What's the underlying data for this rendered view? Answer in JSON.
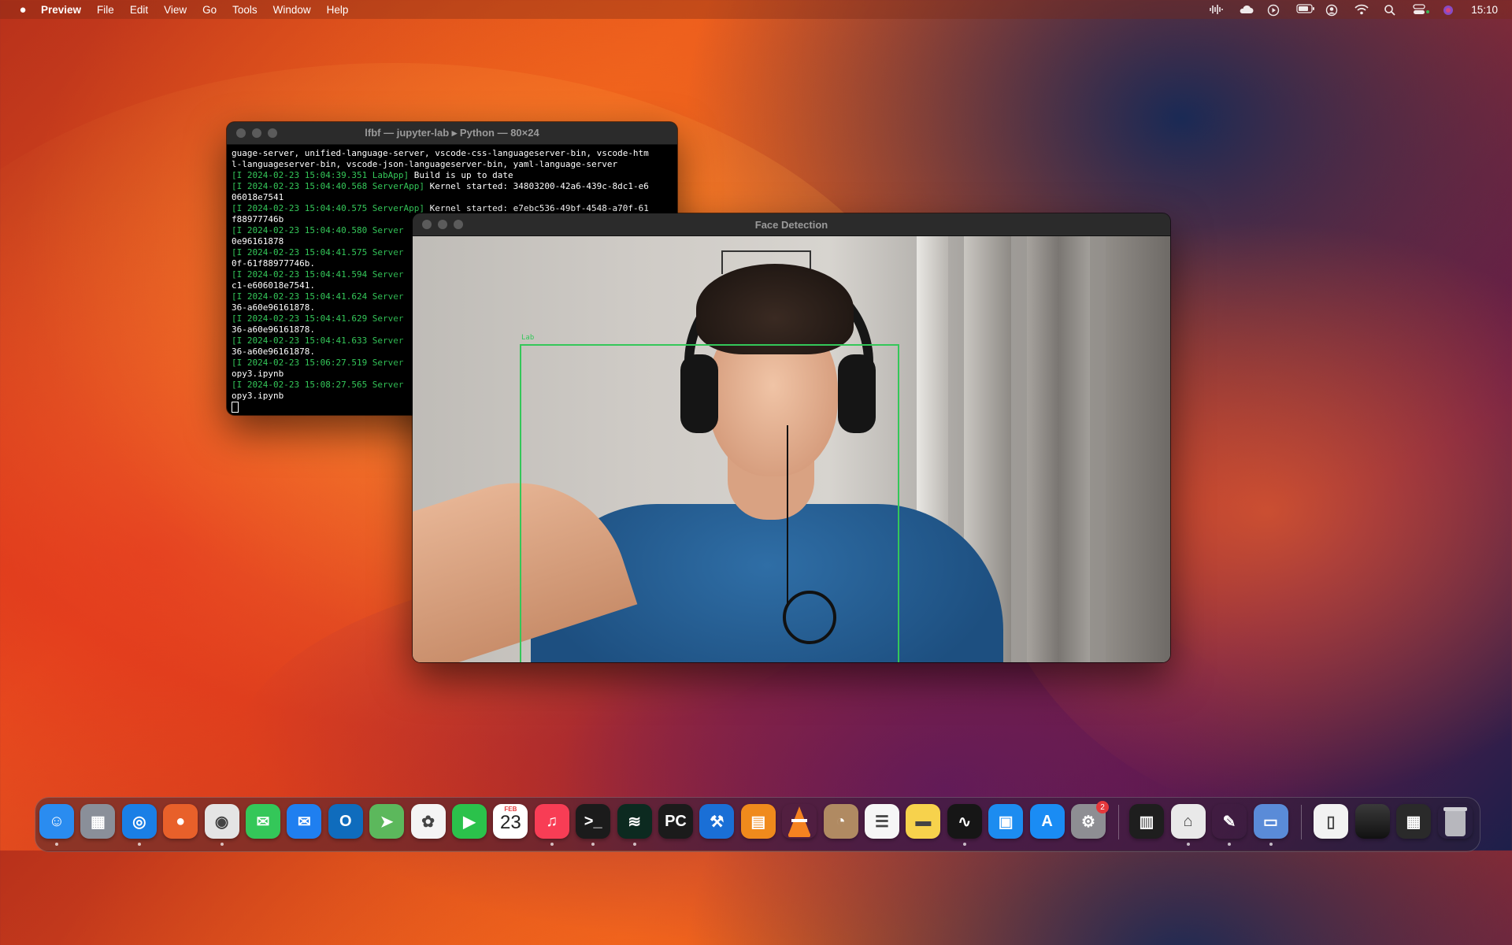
{
  "menubar": {
    "app": "Preview",
    "menus": [
      "File",
      "Edit",
      "View",
      "Go",
      "Tools",
      "Window",
      "Help"
    ],
    "clock": "15:10",
    "status_icons": [
      "waveform-icon",
      "cloud-icon",
      "play-circle-icon",
      "battery-icon",
      "user-circle-icon",
      "wifi-icon",
      "search-icon",
      "control-center-icon",
      "siri-icon"
    ]
  },
  "terminal": {
    "title": "lfbf — jupyter-lab ▸ Python — 80×24",
    "lines": [
      {
        "pre": "",
        "text": "guage-server, unified-language-server, vscode-css-languageserver-bin, vscode-htm"
      },
      {
        "pre": "",
        "text": "l-languageserver-bin, vscode-json-languageserver-bin, yaml-language-server"
      },
      {
        "pre": "[I 2024-02-23 15:04:39.351 LabApp]",
        "text": " Build is up to date"
      },
      {
        "pre": "[I 2024-02-23 15:04:40.568 ServerApp]",
        "text": " Kernel started: 34803200-42a6-439c-8dc1-e6"
      },
      {
        "pre": "",
        "text": "06018e7541"
      },
      {
        "pre": "[I 2024-02-23 15:04:40.575 ServerApp]",
        "text": " Kernel started: e7ebc536-49bf-4548-a70f-61"
      },
      {
        "pre": "",
        "text": "f88977746b"
      },
      {
        "pre": "[I 2024-02-23 15:04:40.580 Server",
        "text": ""
      },
      {
        "pre": "",
        "text": "0e96161878"
      },
      {
        "pre": "[I 2024-02-23 15:04:41.575 Server",
        "text": ""
      },
      {
        "pre": "",
        "text": "0f-61f88977746b."
      },
      {
        "pre": "[I 2024-02-23 15:04:41.594 Server",
        "text": ""
      },
      {
        "pre": "",
        "text": "c1-e606018e7541."
      },
      {
        "pre": "[I 2024-02-23 15:04:41.624 Server",
        "text": ""
      },
      {
        "pre": "",
        "text": "36-a60e96161878."
      },
      {
        "pre": "[I 2024-02-23 15:04:41.629 Server",
        "text": ""
      },
      {
        "pre": "",
        "text": "36-a60e96161878."
      },
      {
        "pre": "[I 2024-02-23 15:04:41.633 Server",
        "text": ""
      },
      {
        "pre": "",
        "text": "36-a60e96161878."
      },
      {
        "pre": "[I 2024-02-23 15:06:27.519 Server",
        "text": ""
      },
      {
        "pre": "",
        "text": "opy3.ipynb"
      },
      {
        "pre": "[I 2024-02-23 15:08:27.565 Server",
        "text": ""
      },
      {
        "pre": "",
        "text": "opy3.ipynb"
      }
    ]
  },
  "face_window": {
    "title": "Face Detection",
    "detection_label": "Lab"
  },
  "dock": {
    "apps": [
      {
        "name": "finder",
        "glyph": "☺",
        "bg": "#2a8cf0",
        "running": true
      },
      {
        "name": "launchpad",
        "glyph": "▦",
        "bg": "#8a8f99",
        "running": false
      },
      {
        "name": "safari",
        "glyph": "◎",
        "bg": "#1a7fe6",
        "running": true
      },
      {
        "name": "firefox",
        "glyph": "●",
        "bg": "#e8602a",
        "running": false
      },
      {
        "name": "chrome",
        "glyph": "◉",
        "bg": "#e4e4e4",
        "running": true
      },
      {
        "name": "messages",
        "glyph": "✉",
        "bg": "#34c759",
        "running": false
      },
      {
        "name": "mail",
        "glyph": "✉",
        "bg": "#1f7ff0",
        "running": false
      },
      {
        "name": "outlook",
        "glyph": "O",
        "bg": "#0f6cbd",
        "running": false
      },
      {
        "name": "maps",
        "glyph": "➤",
        "bg": "#5cb85c",
        "running": false
      },
      {
        "name": "photos",
        "glyph": "✿",
        "bg": "#f4f4f4",
        "running": false
      },
      {
        "name": "facetime",
        "glyph": "▶",
        "bg": "#2bc24b",
        "running": false
      },
      {
        "name": "calendar",
        "glyph": "",
        "bg": "#ffffff",
        "running": false,
        "month": "FEB",
        "day": "23"
      },
      {
        "name": "music",
        "glyph": "♫",
        "bg": "#f83d55",
        "running": true
      },
      {
        "name": "terminal",
        "glyph": ">_",
        "bg": "#1b1b1b",
        "running": true
      },
      {
        "name": "sound-app",
        "glyph": "≋",
        "bg": "#0c2a20",
        "running": true
      },
      {
        "name": "pycharm",
        "glyph": "PC",
        "bg": "#1b1b1b",
        "running": false
      },
      {
        "name": "xcode",
        "glyph": "⚒",
        "bg": "#1a6fd6",
        "running": false
      },
      {
        "name": "books",
        "glyph": "▤",
        "bg": "#f08a1c",
        "running": false
      },
      {
        "name": "vlc",
        "glyph": "▲",
        "bg": "rgba(0,0,0,0)",
        "running": false
      },
      {
        "name": "contacts",
        "glyph": "◔",
        "bg": "#b08a62",
        "running": false
      },
      {
        "name": "reminders",
        "glyph": "☰",
        "bg": "#f6f6f6",
        "running": false
      },
      {
        "name": "notes",
        "glyph": "▬",
        "bg": "#f7d24c",
        "running": false
      },
      {
        "name": "activity-monitor",
        "glyph": "∿",
        "bg": "#161616",
        "running": true
      },
      {
        "name": "keynote",
        "glyph": "▣",
        "bg": "#1c8cf0",
        "running": false
      },
      {
        "name": "app-store",
        "glyph": "A",
        "bg": "#1a8cf4",
        "running": false
      },
      {
        "name": "system-settings",
        "glyph": "⚙",
        "bg": "#8e8e93",
        "running": false,
        "badge": "2"
      }
    ],
    "apps2": [
      {
        "name": "piano-app",
        "glyph": "▥",
        "bg": "#1e1e1e",
        "running": false
      },
      {
        "name": "automator",
        "glyph": "⌂",
        "bg": "#e9e9e9",
        "running": true
      },
      {
        "name": "script-editor",
        "glyph": "✎",
        "bg": "rgba(0,0,0,0)",
        "running": true
      },
      {
        "name": "preview",
        "glyph": "▭",
        "bg": "#5a8bd8",
        "running": true
      }
    ],
    "apps3": [
      {
        "name": "document-icon",
        "glyph": "▯",
        "bg": "#f2f2f2",
        "running": false
      },
      {
        "name": "screenshot-1",
        "glyph": "",
        "bg": "#1a1a1a",
        "running": false
      },
      {
        "name": "screenshot-2",
        "glyph": "▦",
        "bg": "#2a2a2a",
        "running": false
      },
      {
        "name": "trash",
        "glyph": "🗑",
        "bg": "rgba(0,0,0,0)",
        "running": false
      }
    ]
  }
}
